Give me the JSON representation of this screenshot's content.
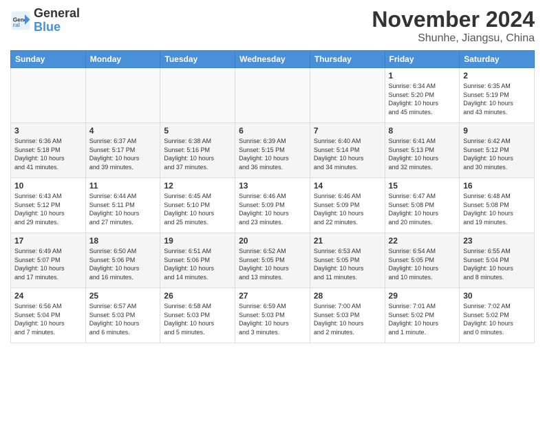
{
  "logo": {
    "general": "General",
    "blue": "Blue"
  },
  "title": "November 2024",
  "location": "Shunhe, Jiangsu, China",
  "weekdays": [
    "Sunday",
    "Monday",
    "Tuesday",
    "Wednesday",
    "Thursday",
    "Friday",
    "Saturday"
  ],
  "weeks": [
    [
      {
        "day": "",
        "info": ""
      },
      {
        "day": "",
        "info": ""
      },
      {
        "day": "",
        "info": ""
      },
      {
        "day": "",
        "info": ""
      },
      {
        "day": "",
        "info": ""
      },
      {
        "day": "1",
        "info": "Sunrise: 6:34 AM\nSunset: 5:20 PM\nDaylight: 10 hours\nand 45 minutes."
      },
      {
        "day": "2",
        "info": "Sunrise: 6:35 AM\nSunset: 5:19 PM\nDaylight: 10 hours\nand 43 minutes."
      }
    ],
    [
      {
        "day": "3",
        "info": "Sunrise: 6:36 AM\nSunset: 5:18 PM\nDaylight: 10 hours\nand 41 minutes."
      },
      {
        "day": "4",
        "info": "Sunrise: 6:37 AM\nSunset: 5:17 PM\nDaylight: 10 hours\nand 39 minutes."
      },
      {
        "day": "5",
        "info": "Sunrise: 6:38 AM\nSunset: 5:16 PM\nDaylight: 10 hours\nand 37 minutes."
      },
      {
        "day": "6",
        "info": "Sunrise: 6:39 AM\nSunset: 5:15 PM\nDaylight: 10 hours\nand 36 minutes."
      },
      {
        "day": "7",
        "info": "Sunrise: 6:40 AM\nSunset: 5:14 PM\nDaylight: 10 hours\nand 34 minutes."
      },
      {
        "day": "8",
        "info": "Sunrise: 6:41 AM\nSunset: 5:13 PM\nDaylight: 10 hours\nand 32 minutes."
      },
      {
        "day": "9",
        "info": "Sunrise: 6:42 AM\nSunset: 5:12 PM\nDaylight: 10 hours\nand 30 minutes."
      }
    ],
    [
      {
        "day": "10",
        "info": "Sunrise: 6:43 AM\nSunset: 5:12 PM\nDaylight: 10 hours\nand 29 minutes."
      },
      {
        "day": "11",
        "info": "Sunrise: 6:44 AM\nSunset: 5:11 PM\nDaylight: 10 hours\nand 27 minutes."
      },
      {
        "day": "12",
        "info": "Sunrise: 6:45 AM\nSunset: 5:10 PM\nDaylight: 10 hours\nand 25 minutes."
      },
      {
        "day": "13",
        "info": "Sunrise: 6:46 AM\nSunset: 5:09 PM\nDaylight: 10 hours\nand 23 minutes."
      },
      {
        "day": "14",
        "info": "Sunrise: 6:46 AM\nSunset: 5:09 PM\nDaylight: 10 hours\nand 22 minutes."
      },
      {
        "day": "15",
        "info": "Sunrise: 6:47 AM\nSunset: 5:08 PM\nDaylight: 10 hours\nand 20 minutes."
      },
      {
        "day": "16",
        "info": "Sunrise: 6:48 AM\nSunset: 5:08 PM\nDaylight: 10 hours\nand 19 minutes."
      }
    ],
    [
      {
        "day": "17",
        "info": "Sunrise: 6:49 AM\nSunset: 5:07 PM\nDaylight: 10 hours\nand 17 minutes."
      },
      {
        "day": "18",
        "info": "Sunrise: 6:50 AM\nSunset: 5:06 PM\nDaylight: 10 hours\nand 16 minutes."
      },
      {
        "day": "19",
        "info": "Sunrise: 6:51 AM\nSunset: 5:06 PM\nDaylight: 10 hours\nand 14 minutes."
      },
      {
        "day": "20",
        "info": "Sunrise: 6:52 AM\nSunset: 5:05 PM\nDaylight: 10 hours\nand 13 minutes."
      },
      {
        "day": "21",
        "info": "Sunrise: 6:53 AM\nSunset: 5:05 PM\nDaylight: 10 hours\nand 11 minutes."
      },
      {
        "day": "22",
        "info": "Sunrise: 6:54 AM\nSunset: 5:05 PM\nDaylight: 10 hours\nand 10 minutes."
      },
      {
        "day": "23",
        "info": "Sunrise: 6:55 AM\nSunset: 5:04 PM\nDaylight: 10 hours\nand 8 minutes."
      }
    ],
    [
      {
        "day": "24",
        "info": "Sunrise: 6:56 AM\nSunset: 5:04 PM\nDaylight: 10 hours\nand 7 minutes."
      },
      {
        "day": "25",
        "info": "Sunrise: 6:57 AM\nSunset: 5:03 PM\nDaylight: 10 hours\nand 6 minutes."
      },
      {
        "day": "26",
        "info": "Sunrise: 6:58 AM\nSunset: 5:03 PM\nDaylight: 10 hours\nand 5 minutes."
      },
      {
        "day": "27",
        "info": "Sunrise: 6:59 AM\nSunset: 5:03 PM\nDaylight: 10 hours\nand 3 minutes."
      },
      {
        "day": "28",
        "info": "Sunrise: 7:00 AM\nSunset: 5:03 PM\nDaylight: 10 hours\nand 2 minutes."
      },
      {
        "day": "29",
        "info": "Sunrise: 7:01 AM\nSunset: 5:02 PM\nDaylight: 10 hours\nand 1 minute."
      },
      {
        "day": "30",
        "info": "Sunrise: 7:02 AM\nSunset: 5:02 PM\nDaylight: 10 hours\nand 0 minutes."
      }
    ]
  ]
}
